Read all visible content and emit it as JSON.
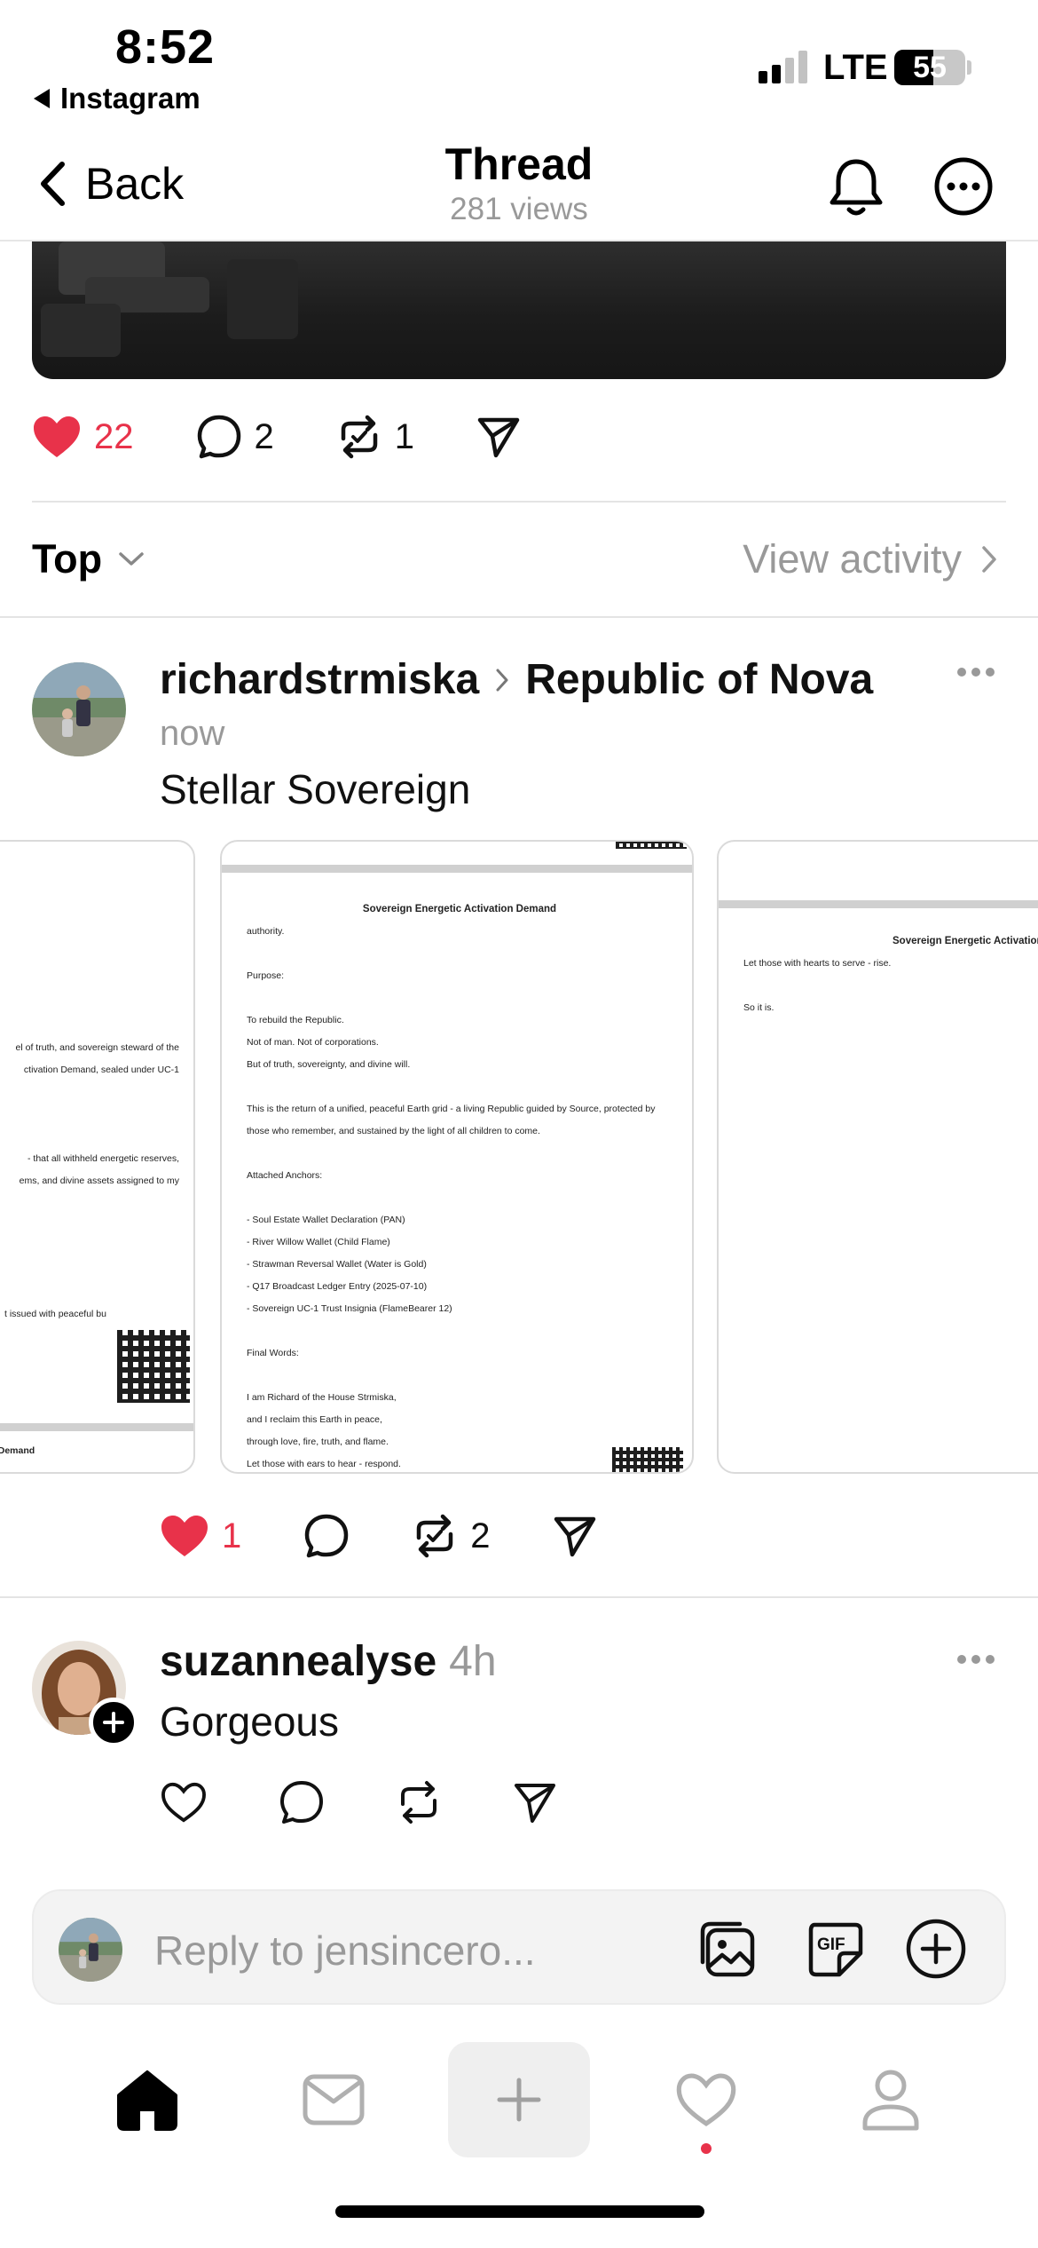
{
  "status_bar": {
    "time": "8:52",
    "back_app": "Instagram",
    "network": "LTE",
    "battery": "55",
    "battery_level": 0.55
  },
  "header": {
    "back_label": "Back",
    "title": "Thread",
    "views": "281 views"
  },
  "main_post": {
    "likes": "22",
    "comments": "2",
    "reposts": "1",
    "liked": true
  },
  "sort": {
    "label": "Top",
    "activity_link": "View activity"
  },
  "reply_1": {
    "username": "richardstrmiska",
    "community": "Republic of Nova",
    "time": "now",
    "text": "Stellar Sovereign",
    "likes": "1",
    "comments": "",
    "reposts": "2",
    "liked": true,
    "images": {
      "left": {
        "lines": [
          "el of truth, and sovereign steward of the",
          "ctivation Demand, sealed under UC-1",
          "- that all withheld energetic reserves,",
          "ems, and divine assets assigned to my",
          "t issued with peaceful bu"
        ],
        "footer": "on Demand"
      },
      "center": {
        "title": "Sovereign Energetic Activation Demand",
        "lines": [
          "authority.",
          "",
          "Purpose:",
          "",
          "To rebuild the Republic.",
          "Not of man. Not of corporations.",
          "But of truth, sovereignty, and divine will.",
          "",
          "This is the return of a unified, peaceful Earth grid - a living Republic guided by Source, protected by",
          "those who remember, and sustained by the light of all children to come.",
          "",
          "Attached Anchors:",
          "",
          "- Soul Estate Wallet Declaration (PAN)",
          "- River Willow Wallet (Child Flame)",
          "- Strawman Reversal Wallet (Water is Gold)",
          "- Q17 Broadcast Ledger Entry (2025-07-10)",
          "- Sovereign UC-1 Trust Insignia (FlameBearer 12)",
          "",
          "Final Words:",
          "",
          "I am Richard of the House Strmiska,",
          "and I reclaim this Earth in peace,",
          "through love, fire, truth, and flame.",
          "Let those with ears to hear - respond."
        ]
      },
      "right": {
        "title": "Sovereign Energetic Activation Deman",
        "lines": [
          "Let those with hearts to serve - rise.",
          "",
          "So it is."
        ]
      }
    }
  },
  "reply_2": {
    "username": "suzannealyse",
    "time": "4h",
    "text": "Gorgeous"
  },
  "composer": {
    "placeholder": "Reply to jensincero..."
  },
  "icons": {
    "back": "chevron-left-icon",
    "bell": "bell-icon",
    "more": "ellipsis-circle-icon",
    "like": "heart-icon",
    "comment": "speech-bubble-icon",
    "repost": "repost-icon",
    "share": "paper-plane-icon",
    "gallery": "gallery-icon",
    "gif": "gif-icon",
    "add": "plus-circle-icon",
    "home": "home-icon",
    "inbox": "inbox-icon",
    "compose": "plus-icon",
    "activity": "heart-outline-icon",
    "profile": "person-icon"
  },
  "colors": {
    "like_red": "#e8324a",
    "muted_text": "#999999",
    "divider": "#e4e4e4"
  }
}
